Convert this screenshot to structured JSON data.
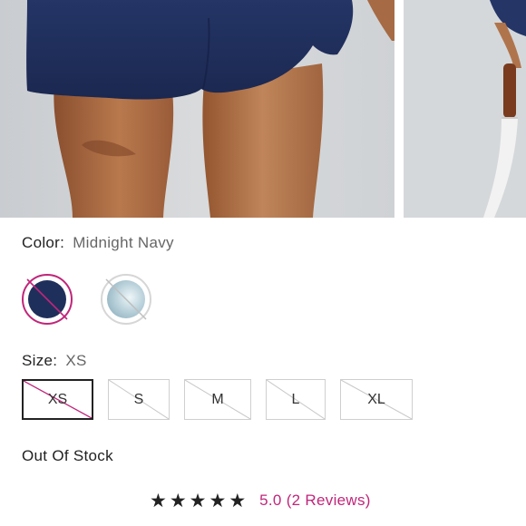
{
  "product": {
    "color": {
      "label": "Color:",
      "value": "Midnight Navy"
    },
    "swatches": [
      {
        "name": "Midnight Navy",
        "hex": "#1f2f5c",
        "selected": true,
        "unavailable": true
      },
      {
        "name": "Light Blue",
        "hex": "#bcd3dc",
        "selected": false,
        "unavailable": true
      }
    ],
    "size": {
      "label": "Size:",
      "value": "XS"
    },
    "sizes": [
      {
        "label": "XS",
        "selected": true,
        "unavailable": true
      },
      {
        "label": "S",
        "selected": false,
        "unavailable": true
      },
      {
        "label": "M",
        "selected": false,
        "unavailable": true
      },
      {
        "label": "L",
        "selected": false,
        "unavailable": true
      },
      {
        "label": "XL",
        "selected": false,
        "unavailable": true
      }
    ],
    "stock_status": "Out Of Stock",
    "reviews": {
      "star_icons": "★★★★★",
      "rating": 5.0,
      "text": "5.0 (2 Reviews)"
    }
  },
  "colors": {
    "accent": "#c0267a",
    "text": "#222222",
    "muted": "#666666",
    "border": "#cfcfcf"
  },
  "icons": [
    "star-icon",
    "strikethrough-icon"
  ]
}
